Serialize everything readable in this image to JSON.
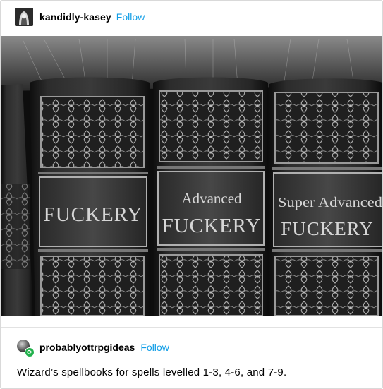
{
  "post": {
    "author": "kandidly-kasey",
    "follow_label": "Follow"
  },
  "image": {
    "books": [
      {
        "lines": [
          "FUCKERY"
        ]
      },
      {
        "lines": [
          "Advanced",
          "FUCKERY"
        ]
      },
      {
        "lines": [
          "Super Advanced",
          "FUCKERY"
        ]
      }
    ]
  },
  "reblog": {
    "author": "probablyottrpgideas",
    "follow_label": "Follow",
    "text": "Wizard’s spellbooks for spells levelled 1-3, 4-6, and 7-9."
  },
  "colors": {
    "follow": "#0f9de6",
    "reblog_badge": "#22b14c"
  }
}
